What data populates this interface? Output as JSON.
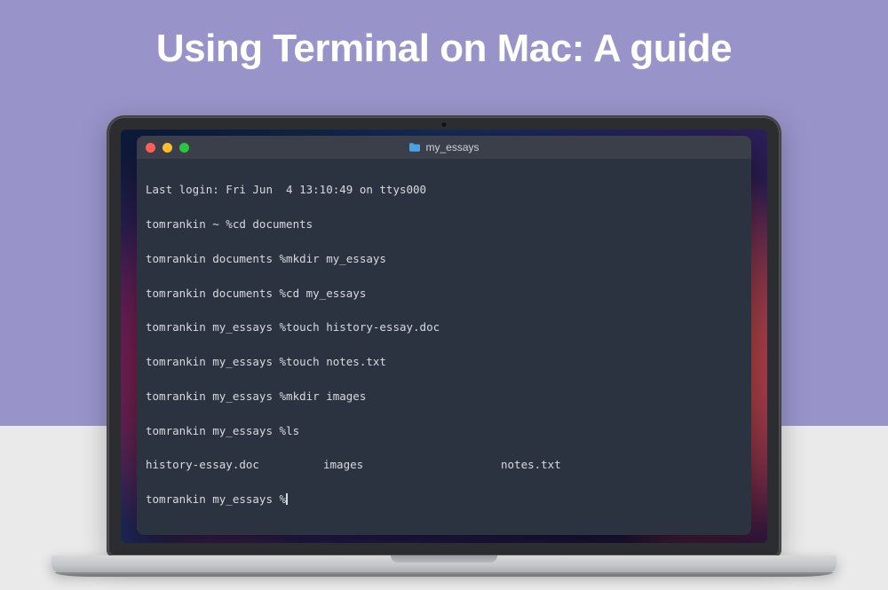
{
  "page": {
    "title": "Using Terminal on Mac: A guide"
  },
  "terminal": {
    "window_title": "my_essays",
    "lines": [
      "Last login: Fri Jun  4 13:10:49 on ttys000",
      "tomrankin ~ %cd documents",
      "tomrankin documents %mkdir my_essays",
      "tomrankin documents %cd my_essays",
      "tomrankin my_essays %touch history-essay.doc",
      "tomrankin my_essays %touch notes.txt",
      "tomrankin my_essays %mkdir images",
      "tomrankin my_essays %ls"
    ],
    "ls_output": {
      "col1": "history-essay.doc",
      "col2": "images",
      "col3": "notes.txt"
    },
    "prompt_line": "tomrankin my_essays %"
  },
  "colors": {
    "bg_top": "#9894ca",
    "bg_bottom": "#eaeaea",
    "terminal_bg": "#2b3240",
    "terminal_text": "#d8dbde"
  }
}
